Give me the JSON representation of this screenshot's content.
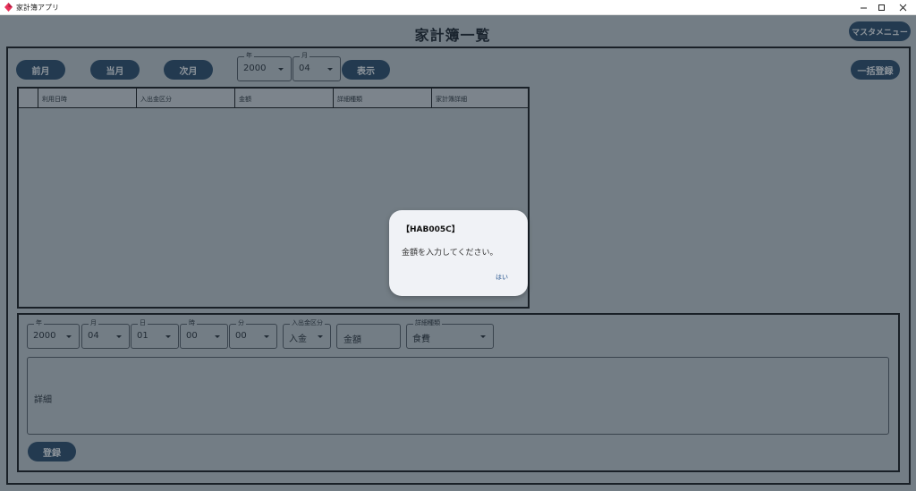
{
  "window": {
    "title": "家計簿アプリ",
    "icon": "app-diamond-icon",
    "accent": "#e8325a"
  },
  "header": {
    "title": "家計簿一覧",
    "master_menu_label": "マスタメニュー"
  },
  "toolbar": {
    "prev_month_label": "前月",
    "current_month_label": "当月",
    "next_month_label": "次月",
    "year": {
      "legend": "年",
      "value": "2000"
    },
    "month": {
      "legend": "月",
      "value": "04"
    },
    "show_label": "表示",
    "bulk_register_label": "一括登録"
  },
  "table": {
    "columns": [
      "",
      "利用日時",
      "入出金区分",
      "金額",
      "詳細種類",
      "家計簿詳細"
    ],
    "rows": []
  },
  "form": {
    "year": {
      "legend": "年",
      "value": "2000"
    },
    "month": {
      "legend": "月",
      "value": "04"
    },
    "day": {
      "legend": "日",
      "value": "01"
    },
    "hour": {
      "legend": "時",
      "value": "00"
    },
    "minute": {
      "legend": "分",
      "value": "00"
    },
    "io_type": {
      "legend": "入出金区分",
      "value": "入金"
    },
    "amount_placeholder": "金額",
    "detail_type": {
      "legend": "詳細種類",
      "value": "食費"
    },
    "details_placeholder": "詳細",
    "register_label": "登録"
  },
  "dialog": {
    "title": "【HAB005C】",
    "message": "金額を入力してください。",
    "ok_label": "はい"
  },
  "colors": {
    "button_bg": "#1f4466",
    "page_bg": "#b9c4cc",
    "dialog_bg": "#f0f2f6"
  }
}
